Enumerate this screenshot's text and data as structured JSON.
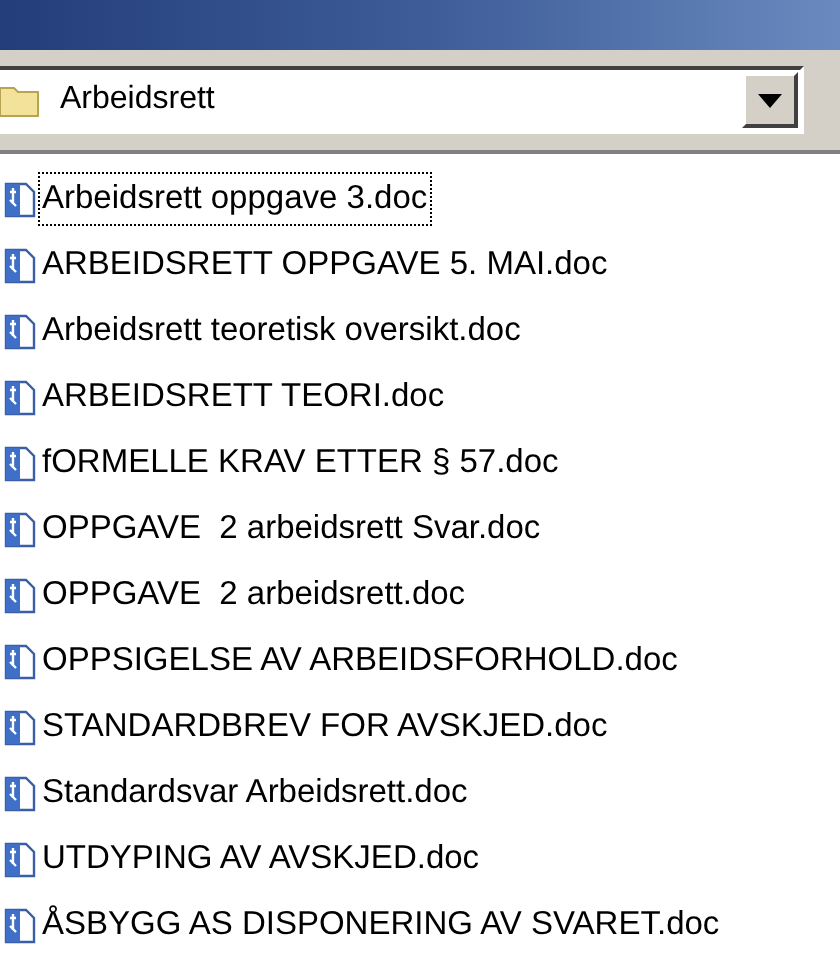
{
  "address_bar": {
    "value": "Arbeidsrett"
  },
  "files": [
    {
      "name": "Arbeidsrett oppgave 3.doc",
      "focused": true
    },
    {
      "name": "ARBEIDSRETT OPPGAVE 5. MAI.doc",
      "focused": false
    },
    {
      "name": "Arbeidsrett teoretisk oversikt.doc",
      "focused": false
    },
    {
      "name": "ARBEIDSRETT TEORI.doc",
      "focused": false
    },
    {
      "name": "fORMELLE KRAV ETTER § 57.doc",
      "focused": false
    },
    {
      "name": "OPPGAVE  2 arbeidsrett Svar.doc",
      "focused": false
    },
    {
      "name": "OPPGAVE  2 arbeidsrett.doc",
      "focused": false
    },
    {
      "name": "OPPSIGELSE AV ARBEIDSFORHOLD.doc",
      "focused": false
    },
    {
      "name": "STANDARDBREV FOR AVSKJED.doc",
      "focused": false
    },
    {
      "name": "Standardsvar Arbeidsrett.doc",
      "focused": false
    },
    {
      "name": "UTDYPING AV AVSKJED.doc",
      "focused": false
    },
    {
      "name": "ÅSBYGG AS DISPONERING AV SVARET.doc",
      "focused": false
    }
  ]
}
